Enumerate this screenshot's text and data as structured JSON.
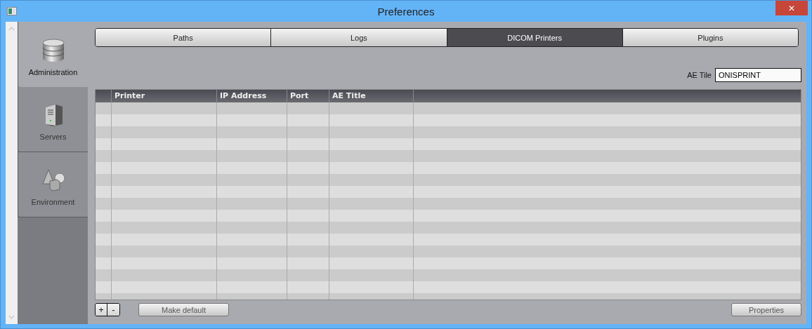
{
  "window": {
    "title": "Preferences",
    "close": "✕"
  },
  "sidebar": {
    "items": [
      {
        "label": "Administration",
        "kind": "database",
        "selected": true
      },
      {
        "label": "Servers",
        "kind": "server",
        "selected": false
      },
      {
        "label": "Environment",
        "kind": "shapes",
        "selected": false
      }
    ]
  },
  "tabs": [
    {
      "label": "Paths",
      "selected": false
    },
    {
      "label": "Logs",
      "selected": false
    },
    {
      "label": "DICOM Printers",
      "selected": true
    },
    {
      "label": "Plugins",
      "selected": false
    }
  ],
  "ae_field": {
    "label": "AE Tile",
    "value": "ONISPRINT"
  },
  "table": {
    "columns": [
      "",
      "Printer",
      "IP Address",
      "Port",
      "AE Title",
      ""
    ]
  },
  "buttons": {
    "add": "+",
    "remove": "-",
    "make_default": "Make default",
    "properties": "Properties"
  }
}
